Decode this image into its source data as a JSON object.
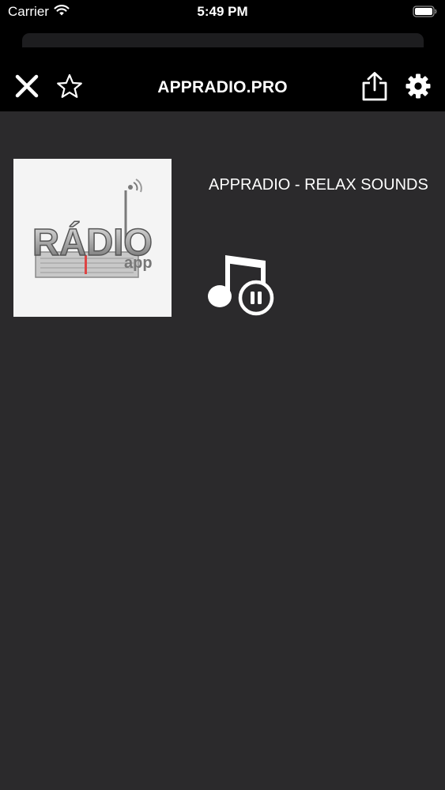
{
  "status_bar": {
    "carrier": "Carrier",
    "time": "5:49 PM"
  },
  "toolbar": {
    "title": "APPRADIO.PRO",
    "icons": [
      "close-icon",
      "star-icon",
      "share-icon",
      "gear-icon"
    ]
  },
  "player": {
    "artwork_text": "RÁDIO",
    "artwork_subtext": "app",
    "station_name": "APPRADIO - RELAX SOUNDS",
    "status_icon": "music-note-pause-icon"
  },
  "colors": {
    "background": "#2b2a2c",
    "header": "#000000",
    "text": "#ffffff"
  }
}
